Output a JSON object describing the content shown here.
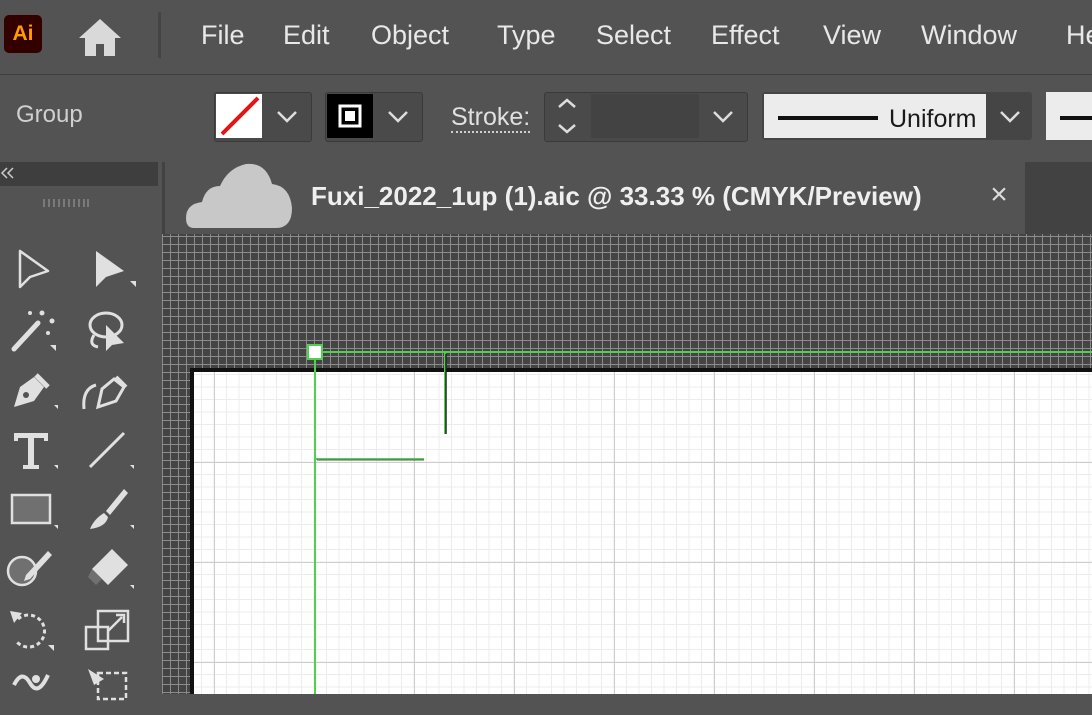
{
  "app": {
    "logo_text": "Ai",
    "logo_bg": "#330000",
    "logo_fg": "#ff9a00"
  },
  "menubar": {
    "items": [
      "File",
      "Edit",
      "Object",
      "Type",
      "Select",
      "Effect",
      "View",
      "Window",
      "He"
    ]
  },
  "control_bar": {
    "selection_label": "Group",
    "fill": {
      "icon": "none-swatch-icon"
    },
    "stroke": {
      "icon": "stroke-swatch-icon"
    },
    "stroke_label": "Stroke:",
    "stroke_weight_value": "",
    "profile_label": "Uniform"
  },
  "document": {
    "tab_title": "Fuxi_2022_1up (1).aic @ 33.33 % (CMYK/Preview)",
    "close_glyph": "×",
    "cloud_icon": "cloud-document-icon"
  },
  "tools": [
    "selection-tool-icon",
    "direct-selection-tool-icon",
    "magic-wand-tool-icon",
    "lasso-tool-icon",
    "pen-tool-icon",
    "curvature-tool-icon",
    "type-tool-icon",
    "line-segment-tool-icon",
    "rectangle-tool-icon",
    "paintbrush-tool-icon",
    "shaper-tool-icon",
    "eraser-tool-icon",
    "rotate-tool-icon",
    "scale-tool-icon",
    "warp-tool-icon",
    "free-transform-tool-icon"
  ],
  "colors": {
    "ui_bg": "#535353",
    "selection_green": "#4fd04f",
    "artboard": "#ffffff"
  }
}
